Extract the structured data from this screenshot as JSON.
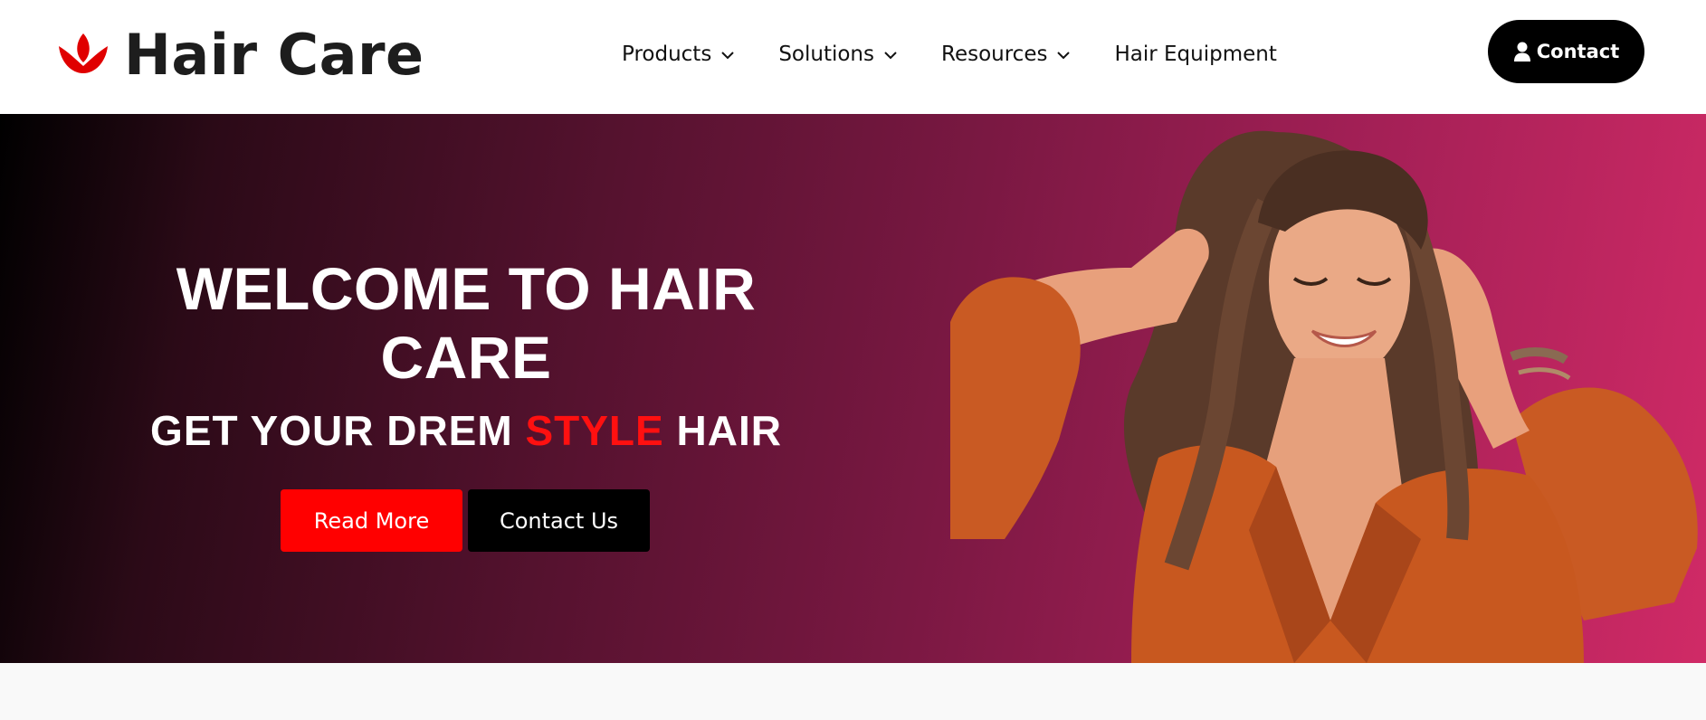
{
  "brand": {
    "name": "Hair Care",
    "icon": "lotus-icon",
    "color": "#e00000"
  },
  "nav": {
    "items": [
      {
        "label": "Products",
        "has_dropdown": true
      },
      {
        "label": "Solutions",
        "has_dropdown": true
      },
      {
        "label": "Resources",
        "has_dropdown": true
      },
      {
        "label": "Hair Equipment",
        "has_dropdown": false
      }
    ],
    "contact_label": "Contact",
    "contact_icon": "user-icon"
  },
  "hero": {
    "title": "WELCOME TO HAIR CARE",
    "subtitle_before": "GET YOUR DREM ",
    "subtitle_accent": "STYLE",
    "subtitle_after": " HAIR",
    "read_more_label": "Read More",
    "contact_us_label": "Contact Us",
    "accent_color": "#ff0000"
  }
}
